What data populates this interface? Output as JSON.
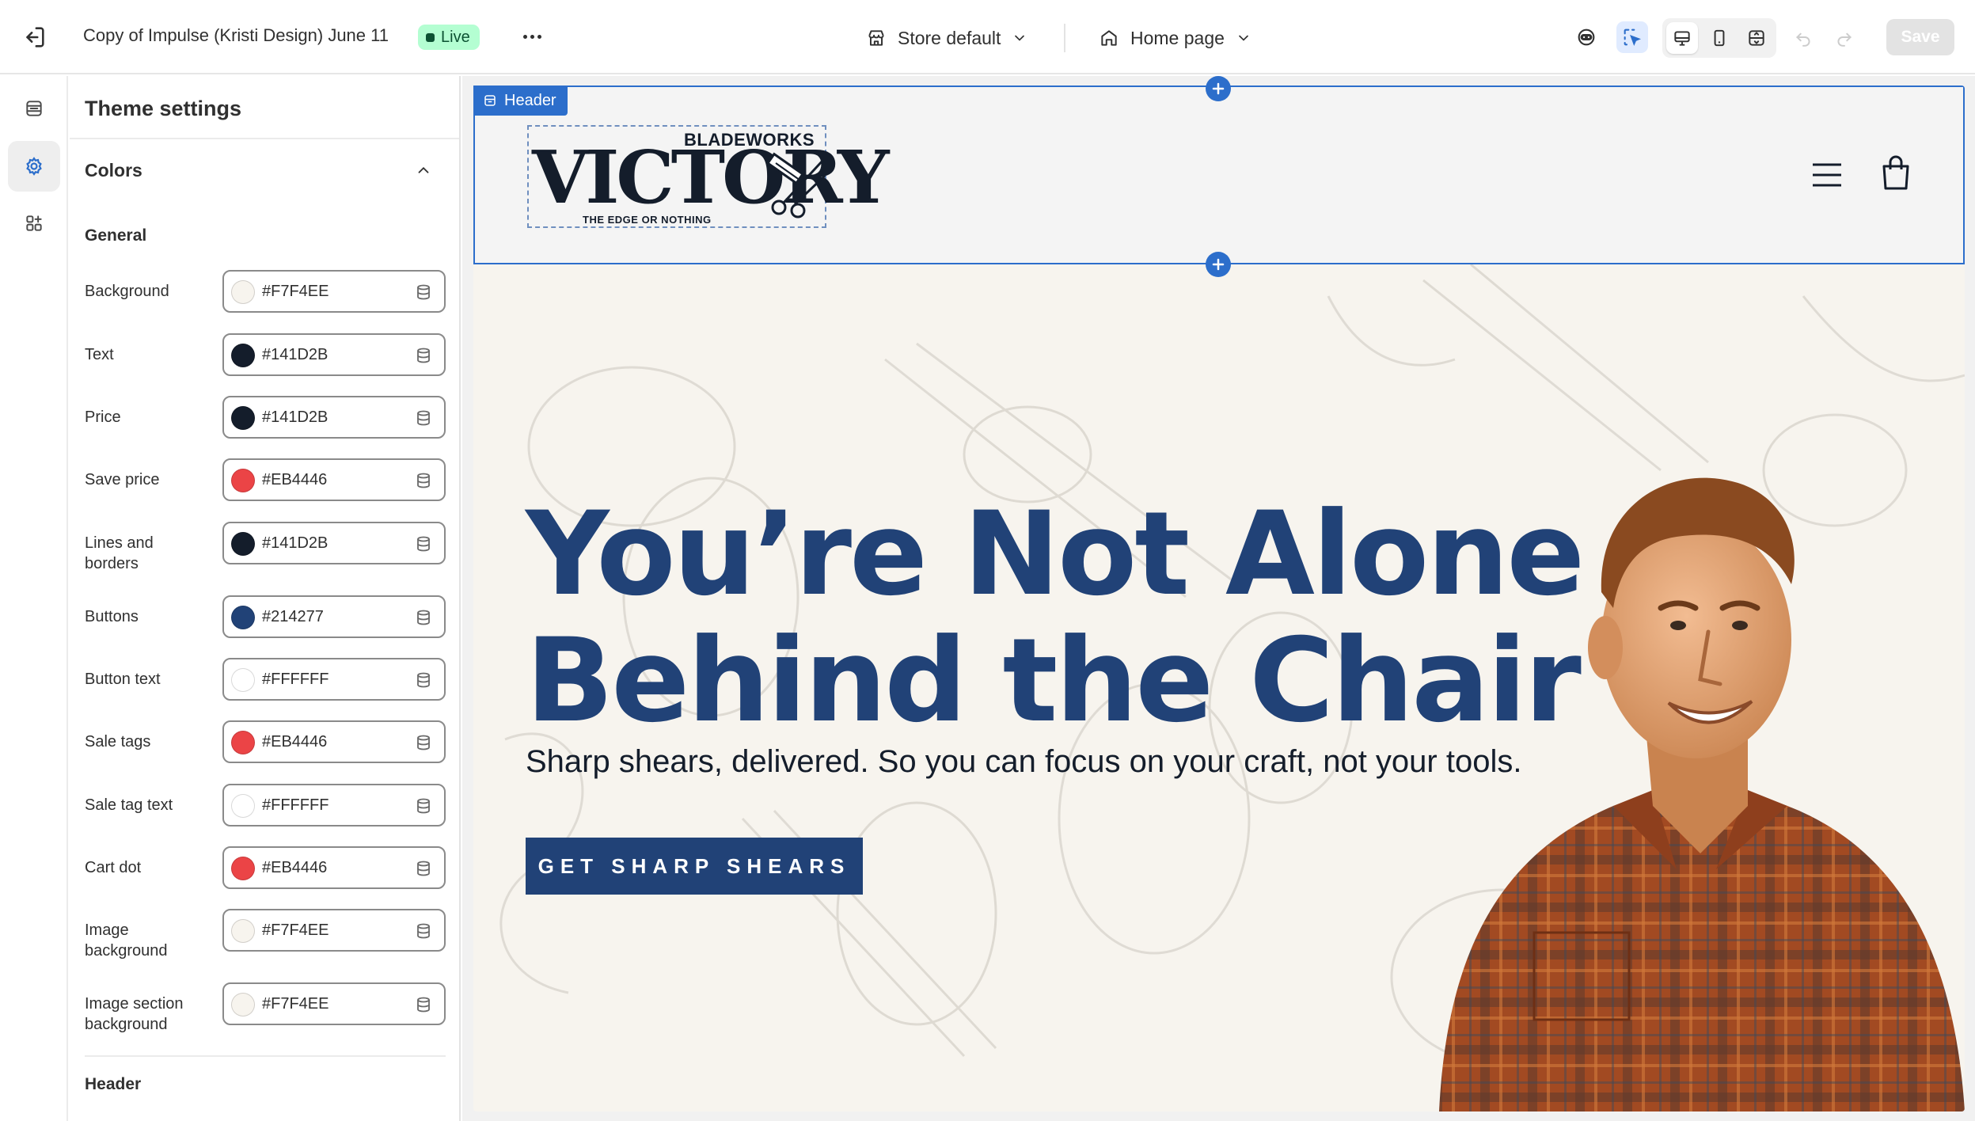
{
  "topbar": {
    "title": "Copy of Impulse (Kristi Design) June 11",
    "live_badge": "Live",
    "store_select": "Store default",
    "page_select": "Home page",
    "save_label": "Save"
  },
  "panel": {
    "title": "Theme settings",
    "section": "Colors",
    "general_title": "General",
    "next_group_title": "Header",
    "colors": [
      {
        "label": "Background",
        "value": "#F7F4EE"
      },
      {
        "label": "Text",
        "value": "#141D2B"
      },
      {
        "label": "Price",
        "value": "#141D2B"
      },
      {
        "label": "Save price",
        "value": "#EB4446"
      },
      {
        "label": "Lines and borders",
        "value": "#141D2B"
      },
      {
        "label": "Buttons",
        "value": "#214277"
      },
      {
        "label": "Button text",
        "value": "#FFFFFF"
      },
      {
        "label": "Sale tags",
        "value": "#EB4446"
      },
      {
        "label": "Sale tag text",
        "value": "#FFFFFF"
      },
      {
        "label": "Cart dot",
        "value": "#EB4446"
      },
      {
        "label": "Image background",
        "value": "#F7F4EE"
      },
      {
        "label": "Image section background",
        "value": "#F7F4EE"
      }
    ]
  },
  "preview": {
    "header_tag": "Header",
    "logo": {
      "top": "BLADEWORKS",
      "main": "VICTORY",
      "tagline": "THE EDGE OR NOTHING"
    },
    "hero": {
      "title_line1": "You’re Not Alone",
      "title_line2": "Behind the Chair",
      "subtitle": "Sharp shears, delivered. So you can focus on your craft, not your tools.",
      "cta": "GET SHARP SHEARS"
    }
  },
  "accent_colors": {
    "selection": "#2C6ECB",
    "brand_blue": "#214277",
    "live_green": "#B4FED2"
  }
}
